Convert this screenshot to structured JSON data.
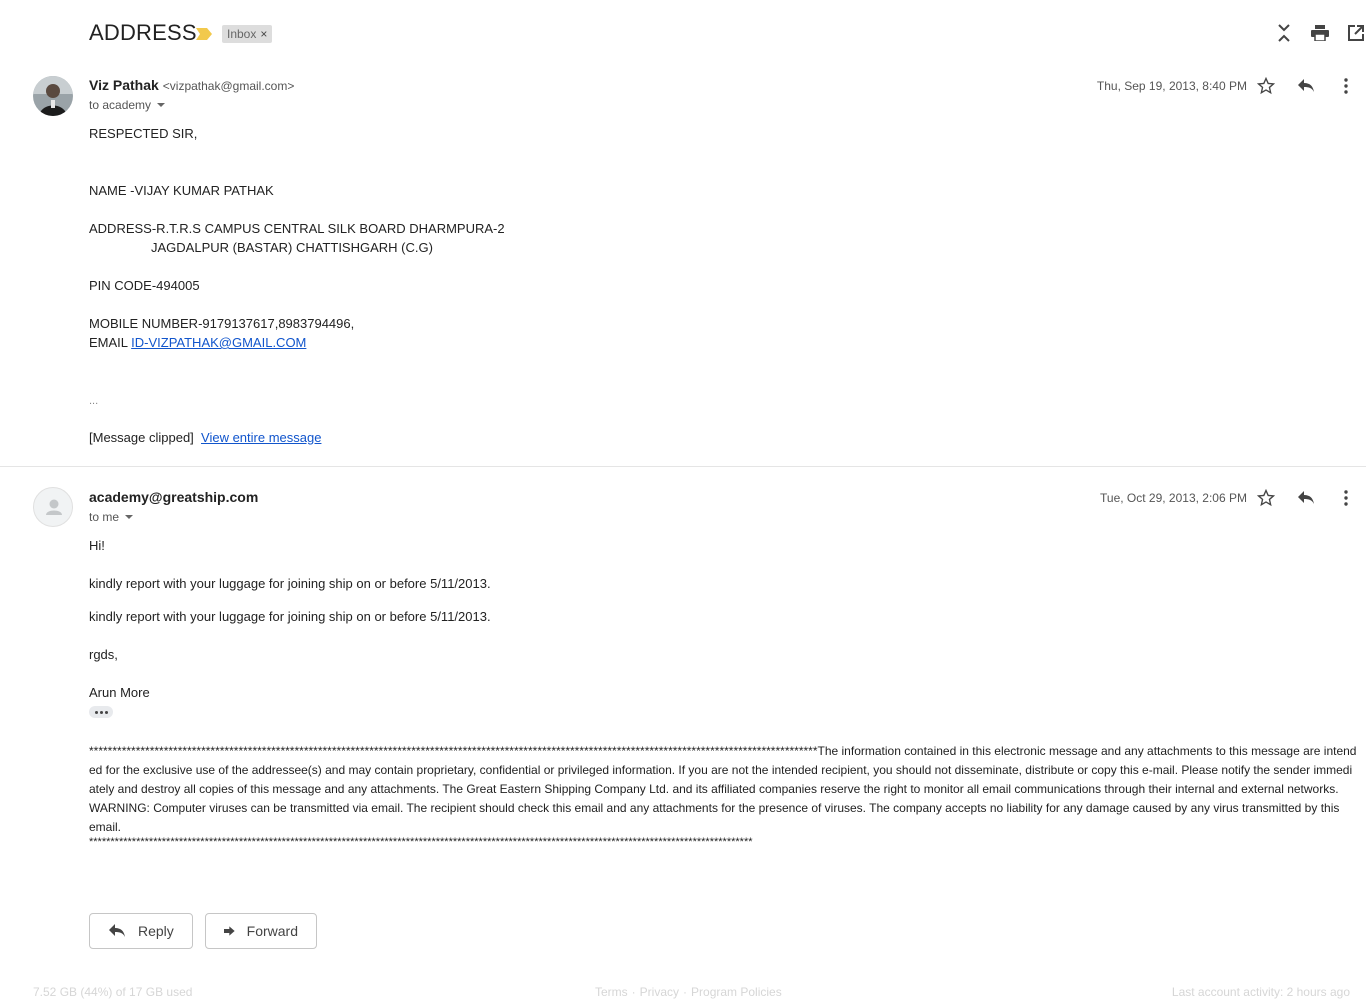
{
  "subject": "ADDRESS",
  "label": "Inbox",
  "label_remove": "×",
  "top_icons": [
    "collapse-all-icon",
    "print-icon",
    "open-in-new-window-icon"
  ],
  "messages": [
    {
      "sender_name": "Viz Pathak",
      "sender_email": "<vizpathak@gmail.com>",
      "to": "to academy",
      "date": "Thu, Sep 19, 2013, 8:40 PM",
      "lines": {
        "l1": "RESPECTED SIR,",
        "l2": "NAME -VIJAY KUMAR PATHAK",
        "l3": "ADDRESS-R.T.R.S CAMPUS CENTRAL SILK BOARD DHARMPURA-2",
        "l4": "JAGDALPUR  (BASTAR)  CHATTISHGARH (C.G)",
        "l5": "PIN CODE-494005",
        "l6": "MOBILE NUMBER-9179137617,8983794496,",
        "l7_prefix": "EMAIL ",
        "l7_link": "ID-VIZPATHAK@GMAIL.COM",
        "l8": "...",
        "clipped": "[Message clipped]",
        "view_entire": "View entire message"
      }
    },
    {
      "sender_name": "academy@greatship.com",
      "to": "to me",
      "date": "Tue, Oct 29, 2013, 2:06 PM",
      "lines": {
        "l1": "Hi!",
        "l2": "kindly report with your luggage for joining ship on or before 5/11/2013.",
        "l3": "kindly report with your luggage for joining ship on or before 5/11/2013.",
        "l4": "rgds,",
        "l5": "Arun More"
      },
      "disclaimer_1": "************************************************************************************************************************************************************The information contained in this electronic message and any attachments to this message are intended for the exclusive use of the addressee(s) and may contain proprietary, confidential or privileged information. If you are not the intended recipient, you should not disseminate, distribute or copy this e-mail. Please notify the sender immediately and destroy all copies of this message and any attachments. The Great Eastern Shipping Company Ltd. and its affiliated companies reserve the right to monitor all email communications through their internal and external networks.",
      "disclaimer_2": "WARNING: Computer viruses can be transmitted via email. The recipient should check this email and any attachments for the presence of viruses. The company accepts no liability for any damage caused by any virus transmitted by this email.",
      "disclaimer_3": "***********************************************************************************************************************************************************"
    }
  ],
  "message_icons": [
    "star-icon",
    "reply-icon",
    "more-vert-icon"
  ],
  "actions": {
    "reply": "Reply",
    "forward": "Forward"
  },
  "footer": {
    "storage": "7.52 GB (44%) of 17 GB used",
    "terms": "Terms",
    "sep1": "·",
    "privacy": "Privacy",
    "sep2": "·",
    "policies": "Program Policies",
    "activity": "Last account activity: 2 hours ago"
  },
  "colors": {
    "link": "#1155cc",
    "importance": "#f2c94c",
    "label_bg": "#dddddd"
  }
}
